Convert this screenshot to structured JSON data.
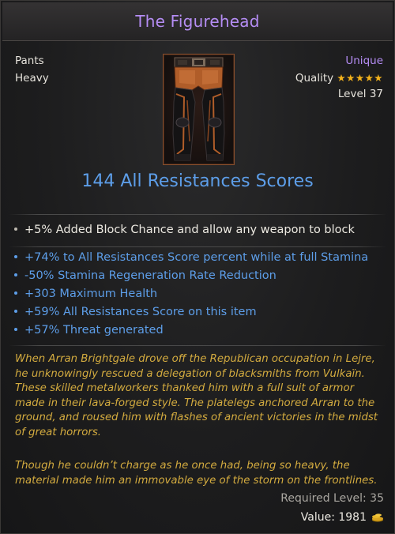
{
  "item": {
    "name": "The Figurehead",
    "type": "Pants",
    "weight": "Heavy",
    "rarity": "Unique",
    "quality_label": "Quality",
    "quality_stars": 5,
    "level": "Level 37"
  },
  "main_stat": "144 All Resistances Scores",
  "implicit": {
    "text": "+5% Added Block Chance and allow any weapon to block"
  },
  "affixes": [
    "+74% to All Resistances Score percent while at full Stamina",
    "-50% Stamina Regeneration Rate Reduction",
    "+303 Maximum Health",
    "+59% All Resistances Score on this item",
    "+57% Threat generated"
  ],
  "lore": {
    "paragraph1": "When Arran Brightgale drove off the Republican occupation in Lejre,\nhe unknowingly rescued a delegation of blacksmiths from Vulkaïn.\nThese skilled metalworkers thanked him with a full suit of armor\nmade in their lava-forged style. The platelegs anchored Arran to the\nground, and roused him with flashes of ancient victories in the midst\nof great horrors.",
    "paragraph2": "Though he couldn’t charge as he once had, being so heavy, the\nmaterial made him an immovable eye of the storm on the frontlines."
  },
  "footer": {
    "required_level": "Required Level: 35",
    "value": "Value: 1981"
  },
  "colors": {
    "title_purple": "#b58df4",
    "stat_blue": "#5d9ee9",
    "lore_gold": "#d3ab3f",
    "star_gold": "#f3b21b"
  }
}
